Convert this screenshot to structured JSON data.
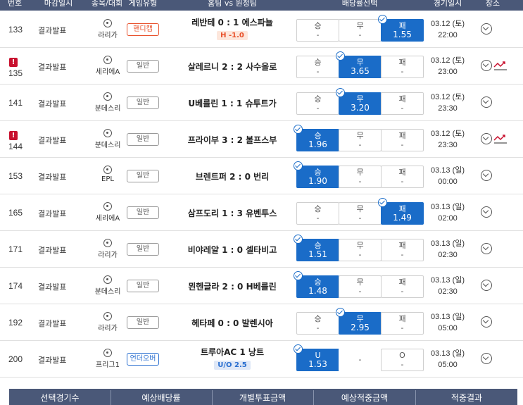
{
  "header": {
    "num": "번호",
    "deadline": "마감일시",
    "league": "종목/대회",
    "type": "게임유형",
    "match": "홈팀 vs 원정팀",
    "odds": "배당률선택",
    "date": "경기일시",
    "location": "장소"
  },
  "colors": {
    "header_bg": "#4a5878",
    "selected": "#1a6cc8",
    "flag": "#c8102e",
    "handicap": "#e8502a",
    "underover": "#2a6fd0"
  },
  "rows": [
    {
      "num": "133",
      "deadline": "결과발표",
      "league": "라리가",
      "type": "핸디캡",
      "type_kind": "hc",
      "match": "레반테 0 : 1 에스파뇰",
      "sub": "H -1.0",
      "odds": [
        {
          "label": "승",
          "value": "-"
        },
        {
          "label": "무",
          "value": "-"
        },
        {
          "label": "패",
          "value": "1.55"
        }
      ],
      "selected": 2,
      "date": "03.12 (토)",
      "time": "22:00",
      "flag": false,
      "trend": false
    },
    {
      "num": "135",
      "deadline": "결과발표",
      "league": "세리에A",
      "type": "일반",
      "type_kind": "n",
      "match": "살레르니 2 : 2 사수올로",
      "sub": "",
      "odds": [
        {
          "label": "승",
          "value": "-"
        },
        {
          "label": "무",
          "value": "3.65"
        },
        {
          "label": "패",
          "value": "-"
        }
      ],
      "selected": 1,
      "date": "03.12 (토)",
      "time": "23:00",
      "flag": true,
      "flag_text": "!",
      "trend": true
    },
    {
      "num": "141",
      "deadline": "결과발표",
      "league": "분데스리",
      "type": "일반",
      "type_kind": "n",
      "match": "U베를린 1 : 1 슈투트가",
      "sub": "",
      "odds": [
        {
          "label": "승",
          "value": "-"
        },
        {
          "label": "무",
          "value": "3.20"
        },
        {
          "label": "패",
          "value": "-"
        }
      ],
      "selected": 1,
      "date": "03.12 (토)",
      "time": "23:30",
      "flag": false,
      "trend": false
    },
    {
      "num": "144",
      "deadline": "결과발표",
      "league": "분데스리",
      "type": "일반",
      "type_kind": "n",
      "match": "프라이부 3 : 2 볼프스부",
      "sub": "",
      "odds": [
        {
          "label": "승",
          "value": "1.96"
        },
        {
          "label": "무",
          "value": "-"
        },
        {
          "label": "패",
          "value": "-"
        }
      ],
      "selected": 0,
      "date": "03.12 (토)",
      "time": "23:30",
      "flag": true,
      "flag_text": "!",
      "trend": true
    },
    {
      "num": "153",
      "deadline": "결과발표",
      "league": "EPL",
      "type": "일반",
      "type_kind": "n",
      "match": "브렌트퍼 2 : 0 번리",
      "sub": "",
      "odds": [
        {
          "label": "승",
          "value": "1.90"
        },
        {
          "label": "무",
          "value": "-"
        },
        {
          "label": "패",
          "value": "-"
        }
      ],
      "selected": 0,
      "date": "03.13 (일)",
      "time": "00:00",
      "flag": false,
      "trend": false
    },
    {
      "num": "165",
      "deadline": "결과발표",
      "league": "세리에A",
      "type": "일반",
      "type_kind": "n",
      "match": "삼프도리 1 : 3 유벤투스",
      "sub": "",
      "odds": [
        {
          "label": "승",
          "value": "-"
        },
        {
          "label": "무",
          "value": "-"
        },
        {
          "label": "패",
          "value": "1.49"
        }
      ],
      "selected": 2,
      "date": "03.13 (일)",
      "time": "02:00",
      "flag": false,
      "trend": false
    },
    {
      "num": "171",
      "deadline": "결과발표",
      "league": "라리가",
      "type": "일반",
      "type_kind": "n",
      "match": "비야레알 1 : 0 셀타비고",
      "sub": "",
      "odds": [
        {
          "label": "승",
          "value": "1.51"
        },
        {
          "label": "무",
          "value": "-"
        },
        {
          "label": "패",
          "value": "-"
        }
      ],
      "selected": 0,
      "date": "03.13 (일)",
      "time": "02:30",
      "flag": false,
      "trend": false
    },
    {
      "num": "174",
      "deadline": "결과발표",
      "league": "분데스리",
      "type": "일반",
      "type_kind": "n",
      "match": "묀헨글라 2 : 0 H베를린",
      "sub": "",
      "odds": [
        {
          "label": "승",
          "value": "1.48"
        },
        {
          "label": "무",
          "value": "-"
        },
        {
          "label": "패",
          "value": "-"
        }
      ],
      "selected": 0,
      "date": "03.13 (일)",
      "time": "02:30",
      "flag": false,
      "trend": false
    },
    {
      "num": "192",
      "deadline": "결과발표",
      "league": "라리가",
      "type": "일반",
      "type_kind": "n",
      "match": "헤타페 0 : 0 발렌시아",
      "sub": "",
      "odds": [
        {
          "label": "승",
          "value": "-"
        },
        {
          "label": "무",
          "value": "2.95"
        },
        {
          "label": "패",
          "value": "-"
        }
      ],
      "selected": 1,
      "date": "03.13 (일)",
      "time": "05:00",
      "flag": false,
      "trend": false
    },
    {
      "num": "200",
      "deadline": "결과발표",
      "league": "프리그1",
      "type": "언더오버",
      "type_kind": "uo",
      "match": "트루아AC   1   낭트",
      "sub": "U/O 2.5",
      "odds": [
        {
          "label": "U",
          "value": "1.53"
        },
        {
          "label": "-",
          "value": ""
        },
        {
          "label": "O",
          "value": "-"
        }
      ],
      "selected": 0,
      "plain_mid": true,
      "date": "03.13 (일)",
      "time": "05:00",
      "flag": false,
      "trend": false
    }
  ],
  "footer": {
    "count": "선택경기수",
    "expected_odds": "예상배당률",
    "stake": "개별투표금액",
    "expected_payout": "예상적중금액",
    "result": "적중결과"
  }
}
